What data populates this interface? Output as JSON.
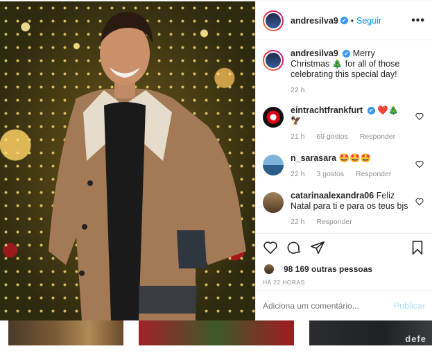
{
  "post": {
    "username": "andresilva9",
    "verified_mark": "✔",
    "dot": "•",
    "follow_label": "Seguir",
    "more_label": "•••"
  },
  "caption": {
    "username": "andresilva9",
    "text": "Merry Christmas 🎄 for all of those celebrating this special day!",
    "time": "22 h"
  },
  "comments": [
    {
      "username": "eintrachtfrankfurt",
      "text": "❤️🎄🦅",
      "time": "21 h",
      "likes": "69 gostos",
      "reply": "Responder"
    },
    {
      "username": "n_sarasara",
      "text": "🤩🤩🤩",
      "time": "22 h",
      "likes": "3 gostos",
      "reply": "Responder"
    },
    {
      "username": "catarinaalexandra06",
      "text": "Feliz Natal para ti e para os teus bjs",
      "time": "22 h",
      "likes": "",
      "reply": "Responder"
    }
  ],
  "likes_text": "98 169 outras pessoas",
  "timestamp": "HÁ 22 HORAS",
  "comment_placeholder": "Adiciona um comentário...",
  "publish_label": "Publicar",
  "thumb_text": "defe",
  "colors": {
    "accent": "#0095f6",
    "publish_disabled": "#b2dffc",
    "muted": "#8e8e8e"
  },
  "icons": [
    "heart-icon",
    "comment-icon",
    "share-icon",
    "bookmark-icon",
    "verified-icon",
    "more-icon"
  ]
}
